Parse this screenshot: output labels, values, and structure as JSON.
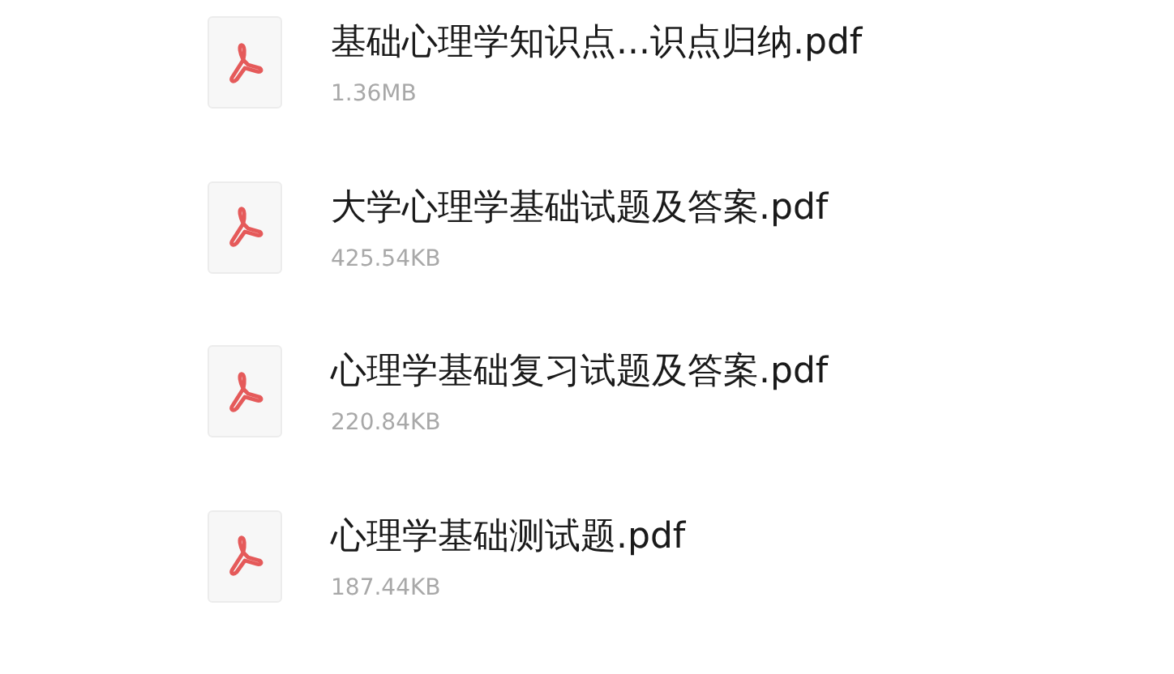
{
  "files": [
    {
      "name": "基础心理学知识点...识点归纳.pdf",
      "size": "1.36MB"
    },
    {
      "name": "大学心理学基础试题及答案.pdf",
      "size": "425.54KB"
    },
    {
      "name": "心理学基础复习试题及答案.pdf",
      "size": "220.84KB"
    },
    {
      "name": "心理学基础测试题.pdf",
      "size": "187.44KB"
    }
  ]
}
